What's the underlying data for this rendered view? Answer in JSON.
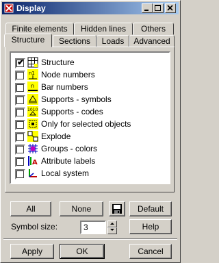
{
  "window": {
    "title": "Display",
    "title_icon": "display-app-icon",
    "controls": [
      "minimize-icon",
      "maximize-icon",
      "close-icon"
    ]
  },
  "tabs_back": [
    {
      "label": "Finite elements"
    },
    {
      "label": "Hidden lines"
    },
    {
      "label": "Others"
    }
  ],
  "tabs_front": [
    {
      "label": "Structure",
      "active": true
    },
    {
      "label": "Sections"
    },
    {
      "label": "Loads"
    },
    {
      "label": "Advanced"
    }
  ],
  "items": [
    {
      "label": "Structure",
      "checked": true,
      "icon": "structure-grid-icon"
    },
    {
      "label": "Node numbers",
      "checked": false,
      "icon": "node-numbers-icon"
    },
    {
      "label": "Bar numbers",
      "checked": false,
      "icon": "bar-numbers-icon"
    },
    {
      "label": "Supports - symbols",
      "checked": false,
      "icon": "support-symbol-icon"
    },
    {
      "label": "Supports - codes",
      "checked": false,
      "icon": "support-code-icon"
    },
    {
      "label": "Only for selected objects",
      "checked": false,
      "icon": "selected-objects-icon"
    },
    {
      "label": "Explode",
      "checked": false,
      "icon": "explode-icon"
    },
    {
      "label": "Groups - colors",
      "checked": false,
      "icon": "groups-colors-icon"
    },
    {
      "label": "Attribute labels",
      "checked": false,
      "icon": "attribute-labels-icon"
    },
    {
      "label": "Local system",
      "checked": false,
      "icon": "local-system-icon"
    }
  ],
  "buttons": {
    "all": "All",
    "none": "None",
    "save_icon": "floppy-disk-icon",
    "default": "Default",
    "help": "Help",
    "apply": "Apply",
    "ok": "OK",
    "cancel": "Cancel"
  },
  "symbol_size": {
    "label": "Symbol size:",
    "value": "3"
  }
}
